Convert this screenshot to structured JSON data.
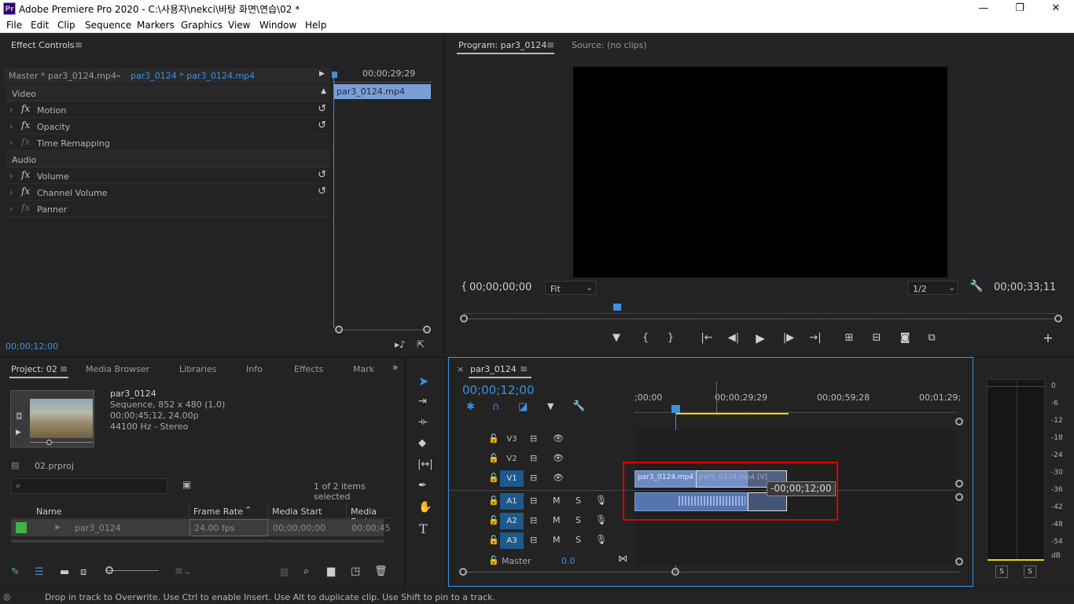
{
  "window": {
    "app_icon": "Pr",
    "title": "Adobe Premiere Pro 2020 - C:\\사용자\\nekci\\바탕 화면\\연습\\02 *",
    "minimize": "—",
    "maximize": "❐",
    "close": "✕"
  },
  "menu": [
    "File",
    "Edit",
    "Clip",
    "Sequence",
    "Markers",
    "Graphics",
    "View",
    "Window",
    "Help"
  ],
  "effect_controls": {
    "title": "Effect Controls",
    "master": "Master * par3_0124.mp4",
    "clip": "par3_0124 * par3_0124.mp4",
    "timecode_top": "00;00;29;29",
    "clip_bar": "par3_0124.mp4",
    "video_label": "Video",
    "audio_label": "Audio",
    "video_effects": [
      "Motion",
      "Opacity",
      "Time Remapping"
    ],
    "audio_effects": [
      "Volume",
      "Channel Volume",
      "Panner"
    ],
    "current_time": "00;00;12;00"
  },
  "program": {
    "tab": "Program: par3_0124",
    "source_tab": "Source: (no clips)",
    "in_time": "00;00;00;00",
    "fit": "Fit",
    "resolution": "1/2",
    "duration": "00;00;33;11"
  },
  "project": {
    "tabs": [
      "Project: 02",
      "Media Browser",
      "Libraries",
      "Info",
      "Effects",
      "Mark"
    ],
    "seq_name": "par3_0124",
    "seq_info": [
      "Sequence, 852 x 480 (1.0)",
      "00;00;45;12, 24.00p",
      "44100 Hz - Stereo"
    ],
    "proj_file": "02.prproj",
    "items_selected": "1 of 2 items selected",
    "columns": [
      "Name",
      "Frame Rate",
      "Media Start",
      "Media End"
    ],
    "row": {
      "name": "par3_0124",
      "frame_rate": "24.00 fps",
      "media_start": "00;00;00;00",
      "media_end": "00;00;45"
    }
  },
  "timeline": {
    "tab": "par3_0124",
    "timecode": "00;00;12;00",
    "ruler": [
      ";00;00",
      "00;00;29;29",
      "00;00;59;28",
      "00;01;29;"
    ],
    "video_tracks": [
      "V3",
      "V2",
      "V1"
    ],
    "audio_tracks": [
      "A1",
      "A2",
      "A3"
    ],
    "master_label": "Master",
    "master_value": "0.0",
    "clip_v_label": "par3_0124.mp4",
    "clip_v_ghost": "par3_0124.mp4 [V]",
    "tooltip": "-00;00;12;00"
  },
  "meter": {
    "scale": [
      "0",
      "-6",
      "-12",
      "-18",
      "-24",
      "-30",
      "-36",
      "-42",
      "-48",
      "-54",
      "dB"
    ],
    "solo": [
      "S",
      "S"
    ]
  },
  "status": "Drop in track to Overwrite. Use Ctrl to enable Insert. Use Alt to duplicate clip. Use Shift to pin to a track.",
  "colors": {
    "accent": "#3b91e0",
    "highlight": "#e00000",
    "clip_video": "#6f8fc4",
    "clip_audio": "#5b7fbf",
    "playhead": "#3b91e0"
  }
}
